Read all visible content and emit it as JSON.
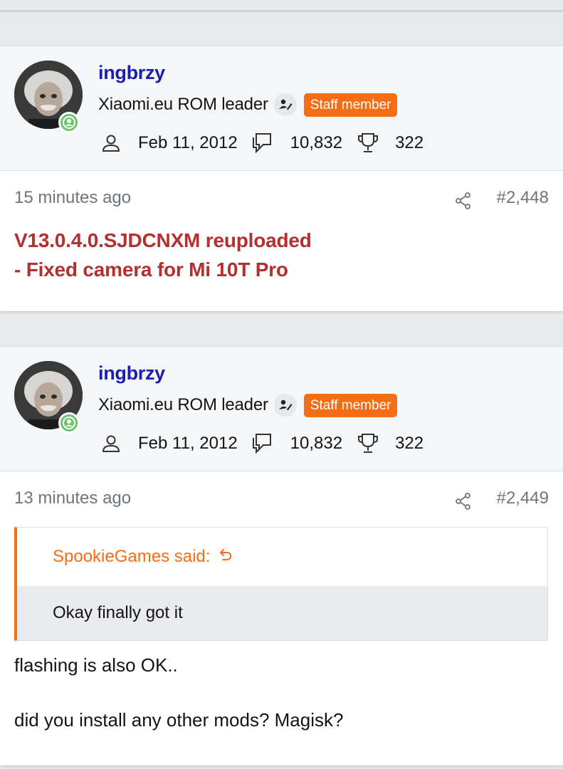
{
  "posts": [
    {
      "username": "ingbrzy",
      "user_title": "Xiaomi.eu ROM leader",
      "staff_badge": "Staff member",
      "joined": "Feb 11, 2012",
      "messages": "10,832",
      "trophies": "322",
      "date": "15 minutes ago",
      "post_number": "#2,448",
      "message_lines": [
        "V13.0.4.0.SJDCNXM reuploaded",
        "- Fixed camera for Mi 10T Pro"
      ]
    },
    {
      "username": "ingbrzy",
      "user_title": "Xiaomi.eu ROM leader",
      "staff_badge": "Staff member",
      "joined": "Feb 11, 2012",
      "messages": "10,832",
      "trophies": "322",
      "date": "13 minutes ago",
      "post_number": "#2,449",
      "quote_author": "SpookieGames said:",
      "quote_text": "Okay finally got it",
      "body_lines": [
        "flashing is also OK..",
        "did you install any other mods? Magisk?"
      ]
    }
  ],
  "icons": {
    "avatar": "avatar-photo",
    "online": "online-status-icon",
    "staff": "staff-pencil-icon",
    "joined": "user-icon",
    "messages": "messages-icon",
    "trophies": "trophy-icon",
    "share": "share-icon",
    "quote_jump": "quote-jump-arrow-icon"
  },
  "colors": {
    "username": "#1d1daf",
    "staff_badge": "#f56e16",
    "message_red": "#b4302e",
    "online_green": "#6bc46b"
  }
}
